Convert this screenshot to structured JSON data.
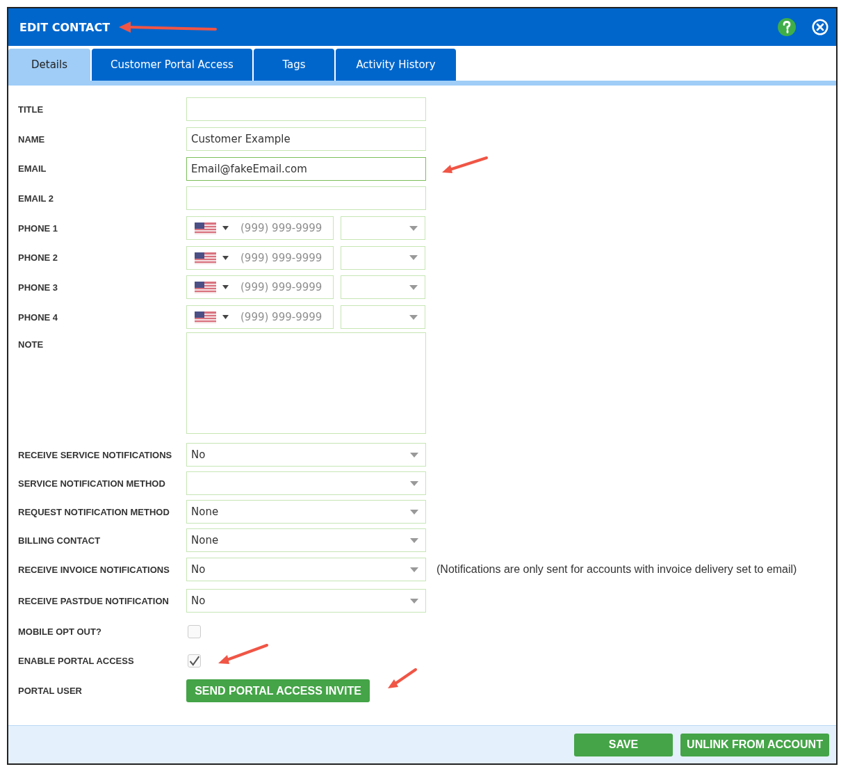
{
  "window": {
    "title": "EDIT CONTACT"
  },
  "tabs": [
    {
      "label": "Details",
      "selected": true
    },
    {
      "label": "Customer Portal Access",
      "selected": false
    },
    {
      "label": "Tags",
      "selected": false
    },
    {
      "label": "Activity History",
      "selected": false
    }
  ],
  "fields": [
    {
      "kind": "text",
      "label": "TITLE"
    },
    {
      "kind": "text",
      "label": "NAME",
      "value": "Customer Example"
    },
    {
      "kind": "text",
      "label": "EMAIL",
      "value": "Email@fakeEmail.com",
      "focused": true
    },
    {
      "kind": "text",
      "label": "EMAIL 2"
    },
    {
      "kind": "phone",
      "label": "PHONE 1",
      "placeholder": "(999) 999-9999"
    },
    {
      "kind": "phone",
      "label": "PHONE 2",
      "placeholder": "(999) 999-9999"
    },
    {
      "kind": "phone",
      "label": "PHONE 3",
      "placeholder": "(999) 999-9999"
    },
    {
      "kind": "phone",
      "label": "PHONE 4",
      "placeholder": "(999) 999-9999"
    },
    {
      "kind": "textarea",
      "label": "NOTE"
    },
    {
      "kind": "select",
      "label": "RECEIVE SERVICE NOTIFICATIONS",
      "value": "No"
    },
    {
      "kind": "select",
      "label": "SERVICE NOTIFICATION METHOD"
    },
    {
      "kind": "select",
      "label": "REQUEST NOTIFICATION METHOD",
      "value": "None"
    },
    {
      "kind": "select",
      "label": "BILLING CONTACT",
      "value": "None"
    },
    {
      "kind": "select",
      "label": "RECEIVE INVOICE NOTIFICATIONS",
      "value": "No",
      "note": "(Notifications are only sent for accounts with invoice delivery set to email)"
    },
    {
      "kind": "select",
      "label": "RECEIVE PASTDUE NOTIFICATION",
      "value": "No"
    },
    {
      "kind": "checkbox",
      "label": "MOBILE OPT OUT?",
      "checked": false
    },
    {
      "kind": "checkbox",
      "label": "ENABLE PORTAL ACCESS",
      "checked": true
    },
    {
      "kind": "button",
      "label": "PORTAL USER",
      "button": "SEND PORTAL ACCESS INVITE"
    }
  ],
  "footer_buttons": [
    "SAVE",
    "UNLINK FROM ACCOUNT"
  ]
}
